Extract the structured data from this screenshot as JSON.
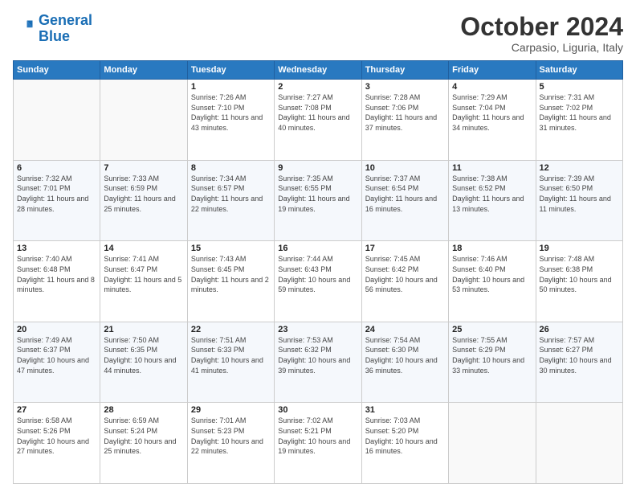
{
  "header": {
    "logo_line1": "General",
    "logo_line2": "Blue",
    "month": "October 2024",
    "location": "Carpasio, Liguria, Italy"
  },
  "weekdays": [
    "Sunday",
    "Monday",
    "Tuesday",
    "Wednesday",
    "Thursday",
    "Friday",
    "Saturday"
  ],
  "weeks": [
    [
      {
        "day": "",
        "info": ""
      },
      {
        "day": "",
        "info": ""
      },
      {
        "day": "1",
        "info": "Sunrise: 7:26 AM\nSunset: 7:10 PM\nDaylight: 11 hours and 43 minutes."
      },
      {
        "day": "2",
        "info": "Sunrise: 7:27 AM\nSunset: 7:08 PM\nDaylight: 11 hours and 40 minutes."
      },
      {
        "day": "3",
        "info": "Sunrise: 7:28 AM\nSunset: 7:06 PM\nDaylight: 11 hours and 37 minutes."
      },
      {
        "day": "4",
        "info": "Sunrise: 7:29 AM\nSunset: 7:04 PM\nDaylight: 11 hours and 34 minutes."
      },
      {
        "day": "5",
        "info": "Sunrise: 7:31 AM\nSunset: 7:02 PM\nDaylight: 11 hours and 31 minutes."
      }
    ],
    [
      {
        "day": "6",
        "info": "Sunrise: 7:32 AM\nSunset: 7:01 PM\nDaylight: 11 hours and 28 minutes."
      },
      {
        "day": "7",
        "info": "Sunrise: 7:33 AM\nSunset: 6:59 PM\nDaylight: 11 hours and 25 minutes."
      },
      {
        "day": "8",
        "info": "Sunrise: 7:34 AM\nSunset: 6:57 PM\nDaylight: 11 hours and 22 minutes."
      },
      {
        "day": "9",
        "info": "Sunrise: 7:35 AM\nSunset: 6:55 PM\nDaylight: 11 hours and 19 minutes."
      },
      {
        "day": "10",
        "info": "Sunrise: 7:37 AM\nSunset: 6:54 PM\nDaylight: 11 hours and 16 minutes."
      },
      {
        "day": "11",
        "info": "Sunrise: 7:38 AM\nSunset: 6:52 PM\nDaylight: 11 hours and 13 minutes."
      },
      {
        "day": "12",
        "info": "Sunrise: 7:39 AM\nSunset: 6:50 PM\nDaylight: 11 hours and 11 minutes."
      }
    ],
    [
      {
        "day": "13",
        "info": "Sunrise: 7:40 AM\nSunset: 6:48 PM\nDaylight: 11 hours and 8 minutes."
      },
      {
        "day": "14",
        "info": "Sunrise: 7:41 AM\nSunset: 6:47 PM\nDaylight: 11 hours and 5 minutes."
      },
      {
        "day": "15",
        "info": "Sunrise: 7:43 AM\nSunset: 6:45 PM\nDaylight: 11 hours and 2 minutes."
      },
      {
        "day": "16",
        "info": "Sunrise: 7:44 AM\nSunset: 6:43 PM\nDaylight: 10 hours and 59 minutes."
      },
      {
        "day": "17",
        "info": "Sunrise: 7:45 AM\nSunset: 6:42 PM\nDaylight: 10 hours and 56 minutes."
      },
      {
        "day": "18",
        "info": "Sunrise: 7:46 AM\nSunset: 6:40 PM\nDaylight: 10 hours and 53 minutes."
      },
      {
        "day": "19",
        "info": "Sunrise: 7:48 AM\nSunset: 6:38 PM\nDaylight: 10 hours and 50 minutes."
      }
    ],
    [
      {
        "day": "20",
        "info": "Sunrise: 7:49 AM\nSunset: 6:37 PM\nDaylight: 10 hours and 47 minutes."
      },
      {
        "day": "21",
        "info": "Sunrise: 7:50 AM\nSunset: 6:35 PM\nDaylight: 10 hours and 44 minutes."
      },
      {
        "day": "22",
        "info": "Sunrise: 7:51 AM\nSunset: 6:33 PM\nDaylight: 10 hours and 41 minutes."
      },
      {
        "day": "23",
        "info": "Sunrise: 7:53 AM\nSunset: 6:32 PM\nDaylight: 10 hours and 39 minutes."
      },
      {
        "day": "24",
        "info": "Sunrise: 7:54 AM\nSunset: 6:30 PM\nDaylight: 10 hours and 36 minutes."
      },
      {
        "day": "25",
        "info": "Sunrise: 7:55 AM\nSunset: 6:29 PM\nDaylight: 10 hours and 33 minutes."
      },
      {
        "day": "26",
        "info": "Sunrise: 7:57 AM\nSunset: 6:27 PM\nDaylight: 10 hours and 30 minutes."
      }
    ],
    [
      {
        "day": "27",
        "info": "Sunrise: 6:58 AM\nSunset: 5:26 PM\nDaylight: 10 hours and 27 minutes."
      },
      {
        "day": "28",
        "info": "Sunrise: 6:59 AM\nSunset: 5:24 PM\nDaylight: 10 hours and 25 minutes."
      },
      {
        "day": "29",
        "info": "Sunrise: 7:01 AM\nSunset: 5:23 PM\nDaylight: 10 hours and 22 minutes."
      },
      {
        "day": "30",
        "info": "Sunrise: 7:02 AM\nSunset: 5:21 PM\nDaylight: 10 hours and 19 minutes."
      },
      {
        "day": "31",
        "info": "Sunrise: 7:03 AM\nSunset: 5:20 PM\nDaylight: 10 hours and 16 minutes."
      },
      {
        "day": "",
        "info": ""
      },
      {
        "day": "",
        "info": ""
      }
    ]
  ]
}
